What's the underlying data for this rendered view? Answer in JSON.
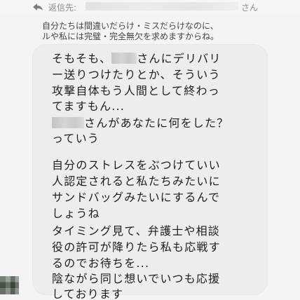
{
  "reply_header": {
    "icon": "reply-arrow-icon",
    "label": "返信先:",
    "recipient_suffix": "さん"
  },
  "quoted_message": [
    "自分たちは間違いだらけ・ミスだらけなのに、",
    "ルや私には完璧・完全無欠を求めますからね。"
  ],
  "message": {
    "lines": [
      {
        "before": "そもそも、",
        "after": "さんにデリバリ"
      },
      {
        "text": "ー送りつけたりとか、そういう"
      },
      {
        "text": "攻撃自体もう人間として終わっ"
      },
      {
        "text": "てますもん..."
      },
      {
        "before": "",
        "after": "さんがあなたに何をした？"
      },
      {
        "text": "っていう"
      },
      {
        "text": "自分のストレスをぶつけていい"
      },
      {
        "text": "人認定されると私たちみたいに"
      },
      {
        "text": "サンドバッグみたいにするんで"
      },
      {
        "text": "しょうね"
      },
      {
        "text": "タイミング見て、弁護士や相談"
      },
      {
        "text": "役の許可が降りたら私も応戦す"
      },
      {
        "text": "るのでお待ちを..."
      },
      {
        "text": "陰ながら同じ想いでいつも応援"
      },
      {
        "text": "しております"
      }
    ]
  },
  "sender": {
    "avatar": "avatar-blurred"
  }
}
